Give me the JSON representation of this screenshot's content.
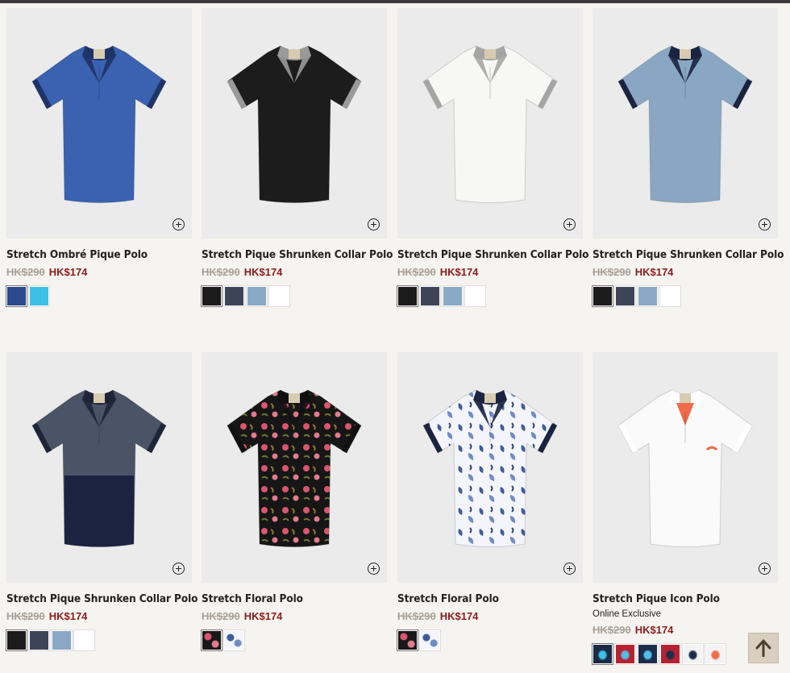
{
  "products": [
    {
      "title": "Stretch Ombré Pique Polo",
      "old_price": "HK$290",
      "new_price": "HK$174",
      "swatches": [
        "#2b4a8c",
        "#3cc0e6"
      ],
      "colors": {
        "body": "#3a62b0",
        "collar": "#1f3366",
        "trim": "#1f3366"
      }
    },
    {
      "title": "Stretch Pique Shrunken Collar Polo",
      "old_price": "HK$290",
      "new_price": "HK$174",
      "swatches": [
        "#1b1b1b",
        "#3e4458",
        "#8aa9c6",
        "#ffffff"
      ],
      "colors": {
        "body": "#1c1c1c",
        "collar": "#9a9a9a",
        "trim": "#9a9a9a"
      }
    },
    {
      "title": "Stretch Pique Shrunken Collar Polo",
      "old_price": "HK$290",
      "new_price": "HK$174",
      "swatches": [
        "#1b1b1b",
        "#3e4458",
        "#8aa9c6",
        "#ffffff"
      ],
      "colors": {
        "body": "#f7f7f5",
        "collar": "#a5a5a5",
        "trim": "#a5a5a5"
      }
    },
    {
      "title": "Stretch Pique Shrunken Collar Polo",
      "old_price": "HK$290",
      "new_price": "HK$174",
      "swatches": [
        "#1b1b1b",
        "#3e4458",
        "#8aa9c6",
        "#ffffff"
      ],
      "colors": {
        "body": "#89a7c2",
        "collar": "#1a2340",
        "trim": "#1a2340"
      }
    },
    {
      "title": "Stretch Pique Shrunken Collar Polo",
      "old_price": "HK$290",
      "new_price": "HK$174",
      "swatches": [
        "#1b1b1b",
        "#3e4458",
        "#8aa9c6",
        "#ffffff"
      ],
      "colors": {
        "body": "#4a5466",
        "collar": "#1e2538",
        "trim": "#1e2538",
        "lower": "#1b2340"
      }
    },
    {
      "title": "Stretch Floral Polo",
      "old_price": "HK$290",
      "new_price": "HK$174",
      "swatches": [
        "floral-dark",
        "floral-light"
      ],
      "colors": {
        "body": "#161616",
        "collar": "#111111",
        "trim": "#111111",
        "pattern": "dark"
      }
    },
    {
      "title": "Stretch Floral Polo",
      "old_price": "HK$290",
      "new_price": "HK$174",
      "swatches": [
        "floral-dark",
        "floral-light"
      ],
      "colors": {
        "body": "#f3f5fa",
        "collar": "#1a2340",
        "trim": "#1a2340",
        "pattern": "light"
      }
    },
    {
      "title": "Stretch Pique Icon Polo",
      "subtitle": "Online Exclusive",
      "old_price": "HK$290",
      "new_price": "HK$174",
      "swatches": [
        "icon-blue",
        "icon-red",
        "icon-navy",
        "icon-red2",
        "icon-white-navy",
        "icon-white-red"
      ],
      "colors": {
        "body": "#fafafa",
        "collar": "#ffffff",
        "trim": "#ffffff",
        "accent": "#ef6b4a"
      }
    }
  ],
  "back_to_top_icon": "arrow-up-icon"
}
